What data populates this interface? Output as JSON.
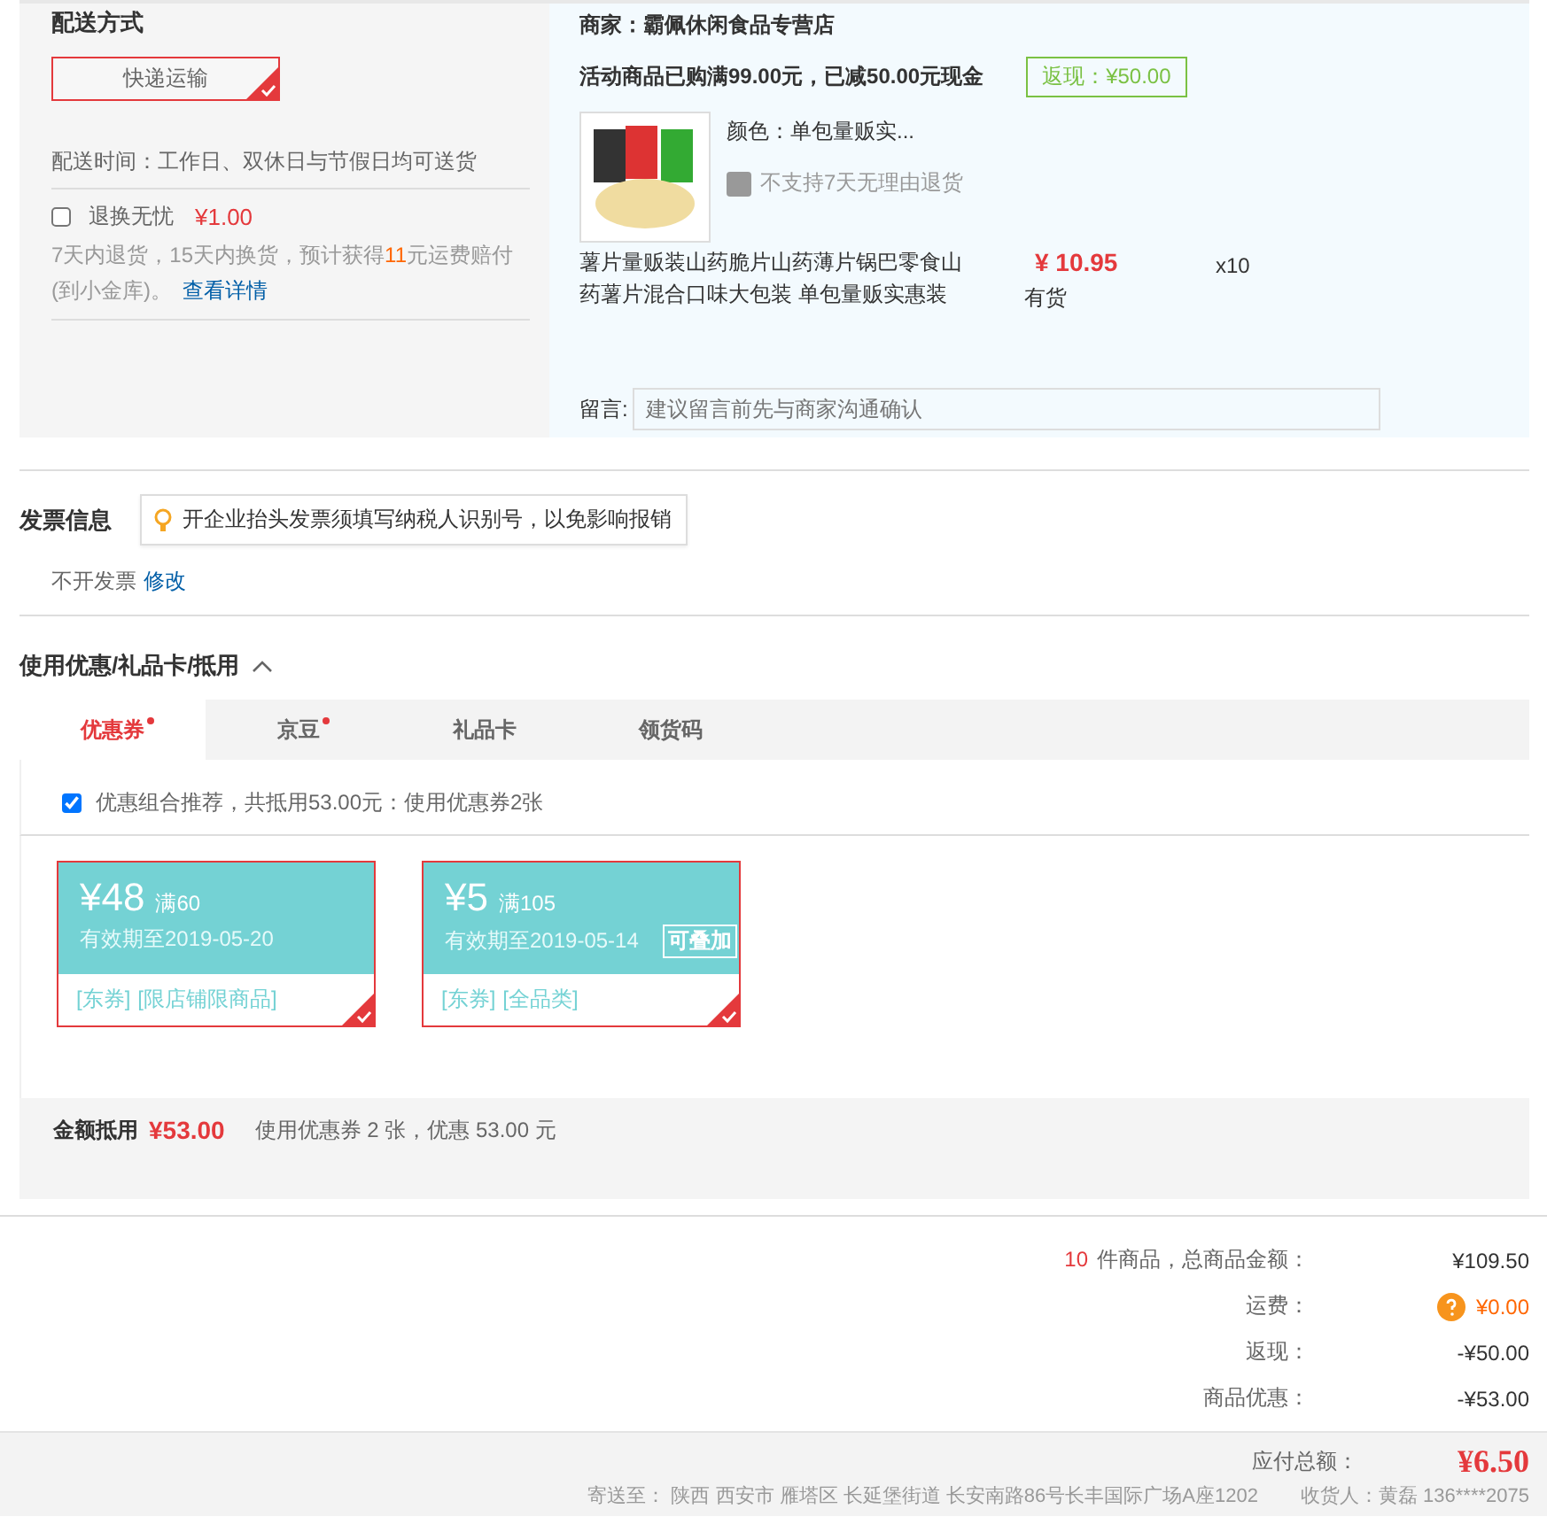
{
  "shipping": {
    "title": "配送方式",
    "methods": [
      {
        "label": "快递运输",
        "selected": true
      }
    ],
    "delivery_time": "配送时间：工作日、双休日与节假日均可送货",
    "insurance": {
      "label": "退换无忧",
      "price": "¥1.00",
      "checked": false
    },
    "insurance_note": [
      "7天内退货，15天内换货，预计获得",
      "11",
      "元运费赔付(到小金库)。"
    ],
    "details_link": "查看详情"
  },
  "seller": {
    "name": "商家：霸佩休闲食品专营店",
    "promo": "活动商品已购满99.00元，已减50.00元现金",
    "cashback_badge": "返现：¥50.00",
    "item": {
      "variant": "颜色：单包量贩实...",
      "return_policy": "不支持7天无理由退货",
      "title": "薯片量贩装山药脆片山药薄片锅巴零食山药薯片混合口味大包装 单包量贩实惠装",
      "price": "¥ 10.95",
      "stock": "有货",
      "quantity": "x10"
    },
    "message": {
      "label": "留言:",
      "placeholder": "建议留言前先与商家沟通确认"
    }
  },
  "invoice": {
    "title": "发票信息",
    "tip": "开企业抬头发票须填写纳税人识别号，以免影响报销",
    "value": "不开发票",
    "edit_link": "修改"
  },
  "discounts": {
    "title": "使用优惠/礼品卡/抵用",
    "expanded": true,
    "tabs": [
      {
        "label": "优惠券",
        "selected": true,
        "dot": true
      },
      {
        "label": "京豆",
        "selected": false,
        "dot": true
      },
      {
        "label": "礼品卡",
        "selected": false,
        "dot": false
      },
      {
        "label": "领货码",
        "selected": false,
        "dot": false
      }
    ],
    "recommend": {
      "label": "优惠组合推荐，共抵用53.00元：使用优惠券2张",
      "checked": true
    },
    "coupons": [
      {
        "amount": "¥48",
        "threshold": "满60",
        "expiry": "有效期至2019-05-20",
        "tags": [
          "[东券]",
          "[限店铺限商品]"
        ],
        "selected": true
      },
      {
        "amount": "¥5",
        "threshold": "满105",
        "expiry": "有效期至2019-05-14",
        "stackable": "可叠加",
        "tags": [
          "[东券]",
          "[全品类]"
        ],
        "selected": true
      }
    ],
    "summary": {
      "label": "金额抵用",
      "amount": "¥53.00",
      "note": "使用优惠券 2 张，优惠 53.00 元"
    }
  },
  "totals": [
    {
      "count": "10",
      "label": "件商品，总商品金额：",
      "value": "¥109.50",
      "help": false
    },
    {
      "label": "运费：",
      "value": "¥0.00",
      "help": true
    },
    {
      "label": "返现：",
      "value": "-¥50.00",
      "help": false
    },
    {
      "label": "商品优惠：",
      "value": "-¥53.00",
      "help": false
    }
  ],
  "footer": {
    "payable_label": "应付总额：",
    "payable": "¥6.50",
    "address": "寄送至： 陕西 西安市 雁塔区 长延堡街道 长安南路86号长丰国际广场A座1202",
    "receiver": "收货人：黄磊 136****2075"
  }
}
